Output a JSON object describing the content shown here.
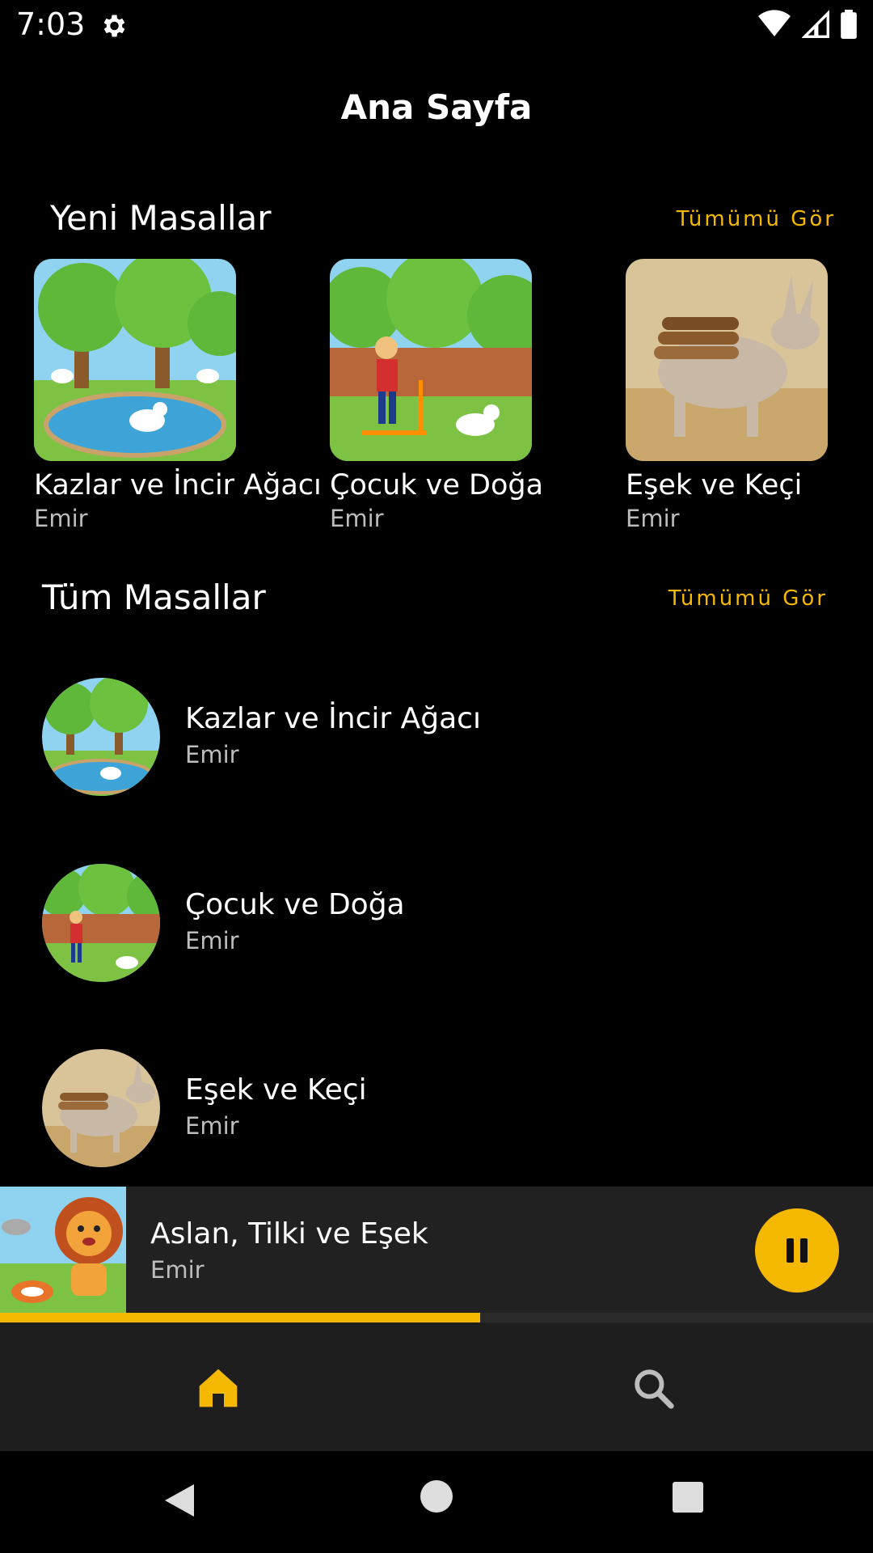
{
  "status_bar": {
    "time": "7:03",
    "icons": [
      "gear-icon",
      "wifi-icon",
      "signal-icon",
      "battery-icon"
    ]
  },
  "header": {
    "title": "Ana Sayfa"
  },
  "new_stories": {
    "title": "Yeni Masallar",
    "see_all": "Tümümü Gör",
    "items": [
      {
        "title": "Kazlar ve İncir Ağacı",
        "author": "Emir"
      },
      {
        "title": "Çocuk ve Doğa",
        "author": "Emir"
      },
      {
        "title": "Eşek ve Keçi",
        "author": "Emir"
      }
    ]
  },
  "all_stories": {
    "title": "Tüm Masallar",
    "see_all": "Tümümü Gör",
    "items": [
      {
        "title": "Kazlar ve İncir Ağacı",
        "author": "Emir"
      },
      {
        "title": "Çocuk ve Doğa",
        "author": "Emir"
      },
      {
        "title": "Eşek ve Keçi",
        "author": "Emir"
      }
    ]
  },
  "player": {
    "title": "Aslan, Tilki ve Eşek",
    "author": "Emir",
    "progress": 0.55,
    "state_icon": "pause-icon"
  },
  "bottom_nav": {
    "items": [
      "home-icon",
      "search-icon"
    ],
    "active": "home-icon"
  },
  "colors": {
    "accent": "#f5b800",
    "background": "#000000",
    "surface": "#212121"
  }
}
